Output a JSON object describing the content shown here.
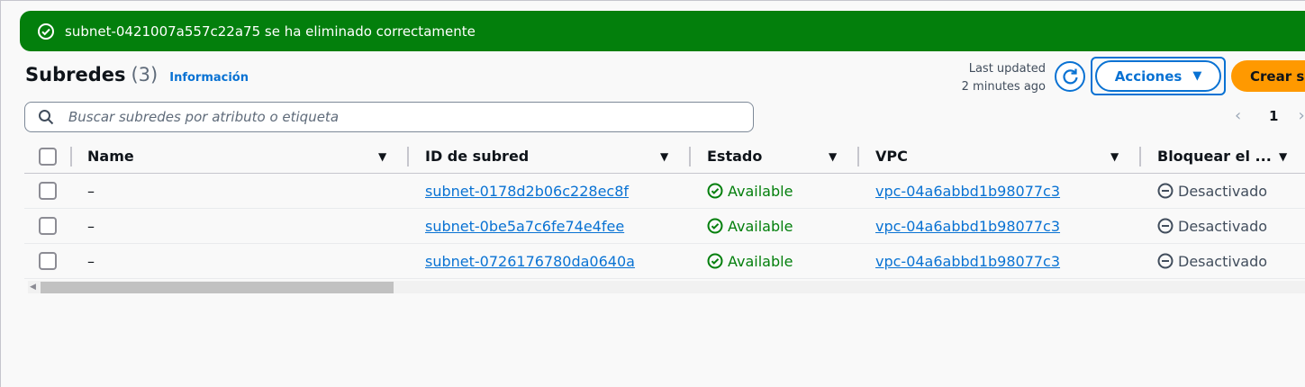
{
  "flash": {
    "message": "subnet-0421007a557c22a75 se ha eliminado correctamente",
    "color": "#037f0c"
  },
  "header": {
    "title": "Subredes",
    "count": "(3)",
    "info_link": "Información",
    "last_updated_line1": "Last updated",
    "last_updated_line2": "2 minutes ago",
    "actions_label": "Acciones",
    "create_label": "Crear subred"
  },
  "search": {
    "placeholder": "Buscar subredes por atributo o etiqueta"
  },
  "pagination": {
    "current_page": "1"
  },
  "table": {
    "columns": [
      "Name",
      "ID de subred",
      "Estado",
      "VPC",
      "Bloquear el ..."
    ],
    "rows": [
      {
        "name": "–",
        "subnet_id": "subnet-0178d2b06c228ec8f",
        "state": "Available",
        "vpc": "vpc-04a6abbd1b98077c3",
        "block": "Desactivado"
      },
      {
        "name": "–",
        "subnet_id": "subnet-0be5a7c6fe74e4fee",
        "state": "Available",
        "vpc": "vpc-04a6abbd1b98077c3",
        "block": "Desactivado"
      },
      {
        "name": "–",
        "subnet_id": "subnet-0726176780da0640a",
        "state": "Available",
        "vpc": "vpc-04a6abbd1b98077c3",
        "block": "Desactivado"
      }
    ]
  },
  "colors": {
    "accent": "#0972d3",
    "primary_button": "#ff9900",
    "success": "#037f0c"
  }
}
